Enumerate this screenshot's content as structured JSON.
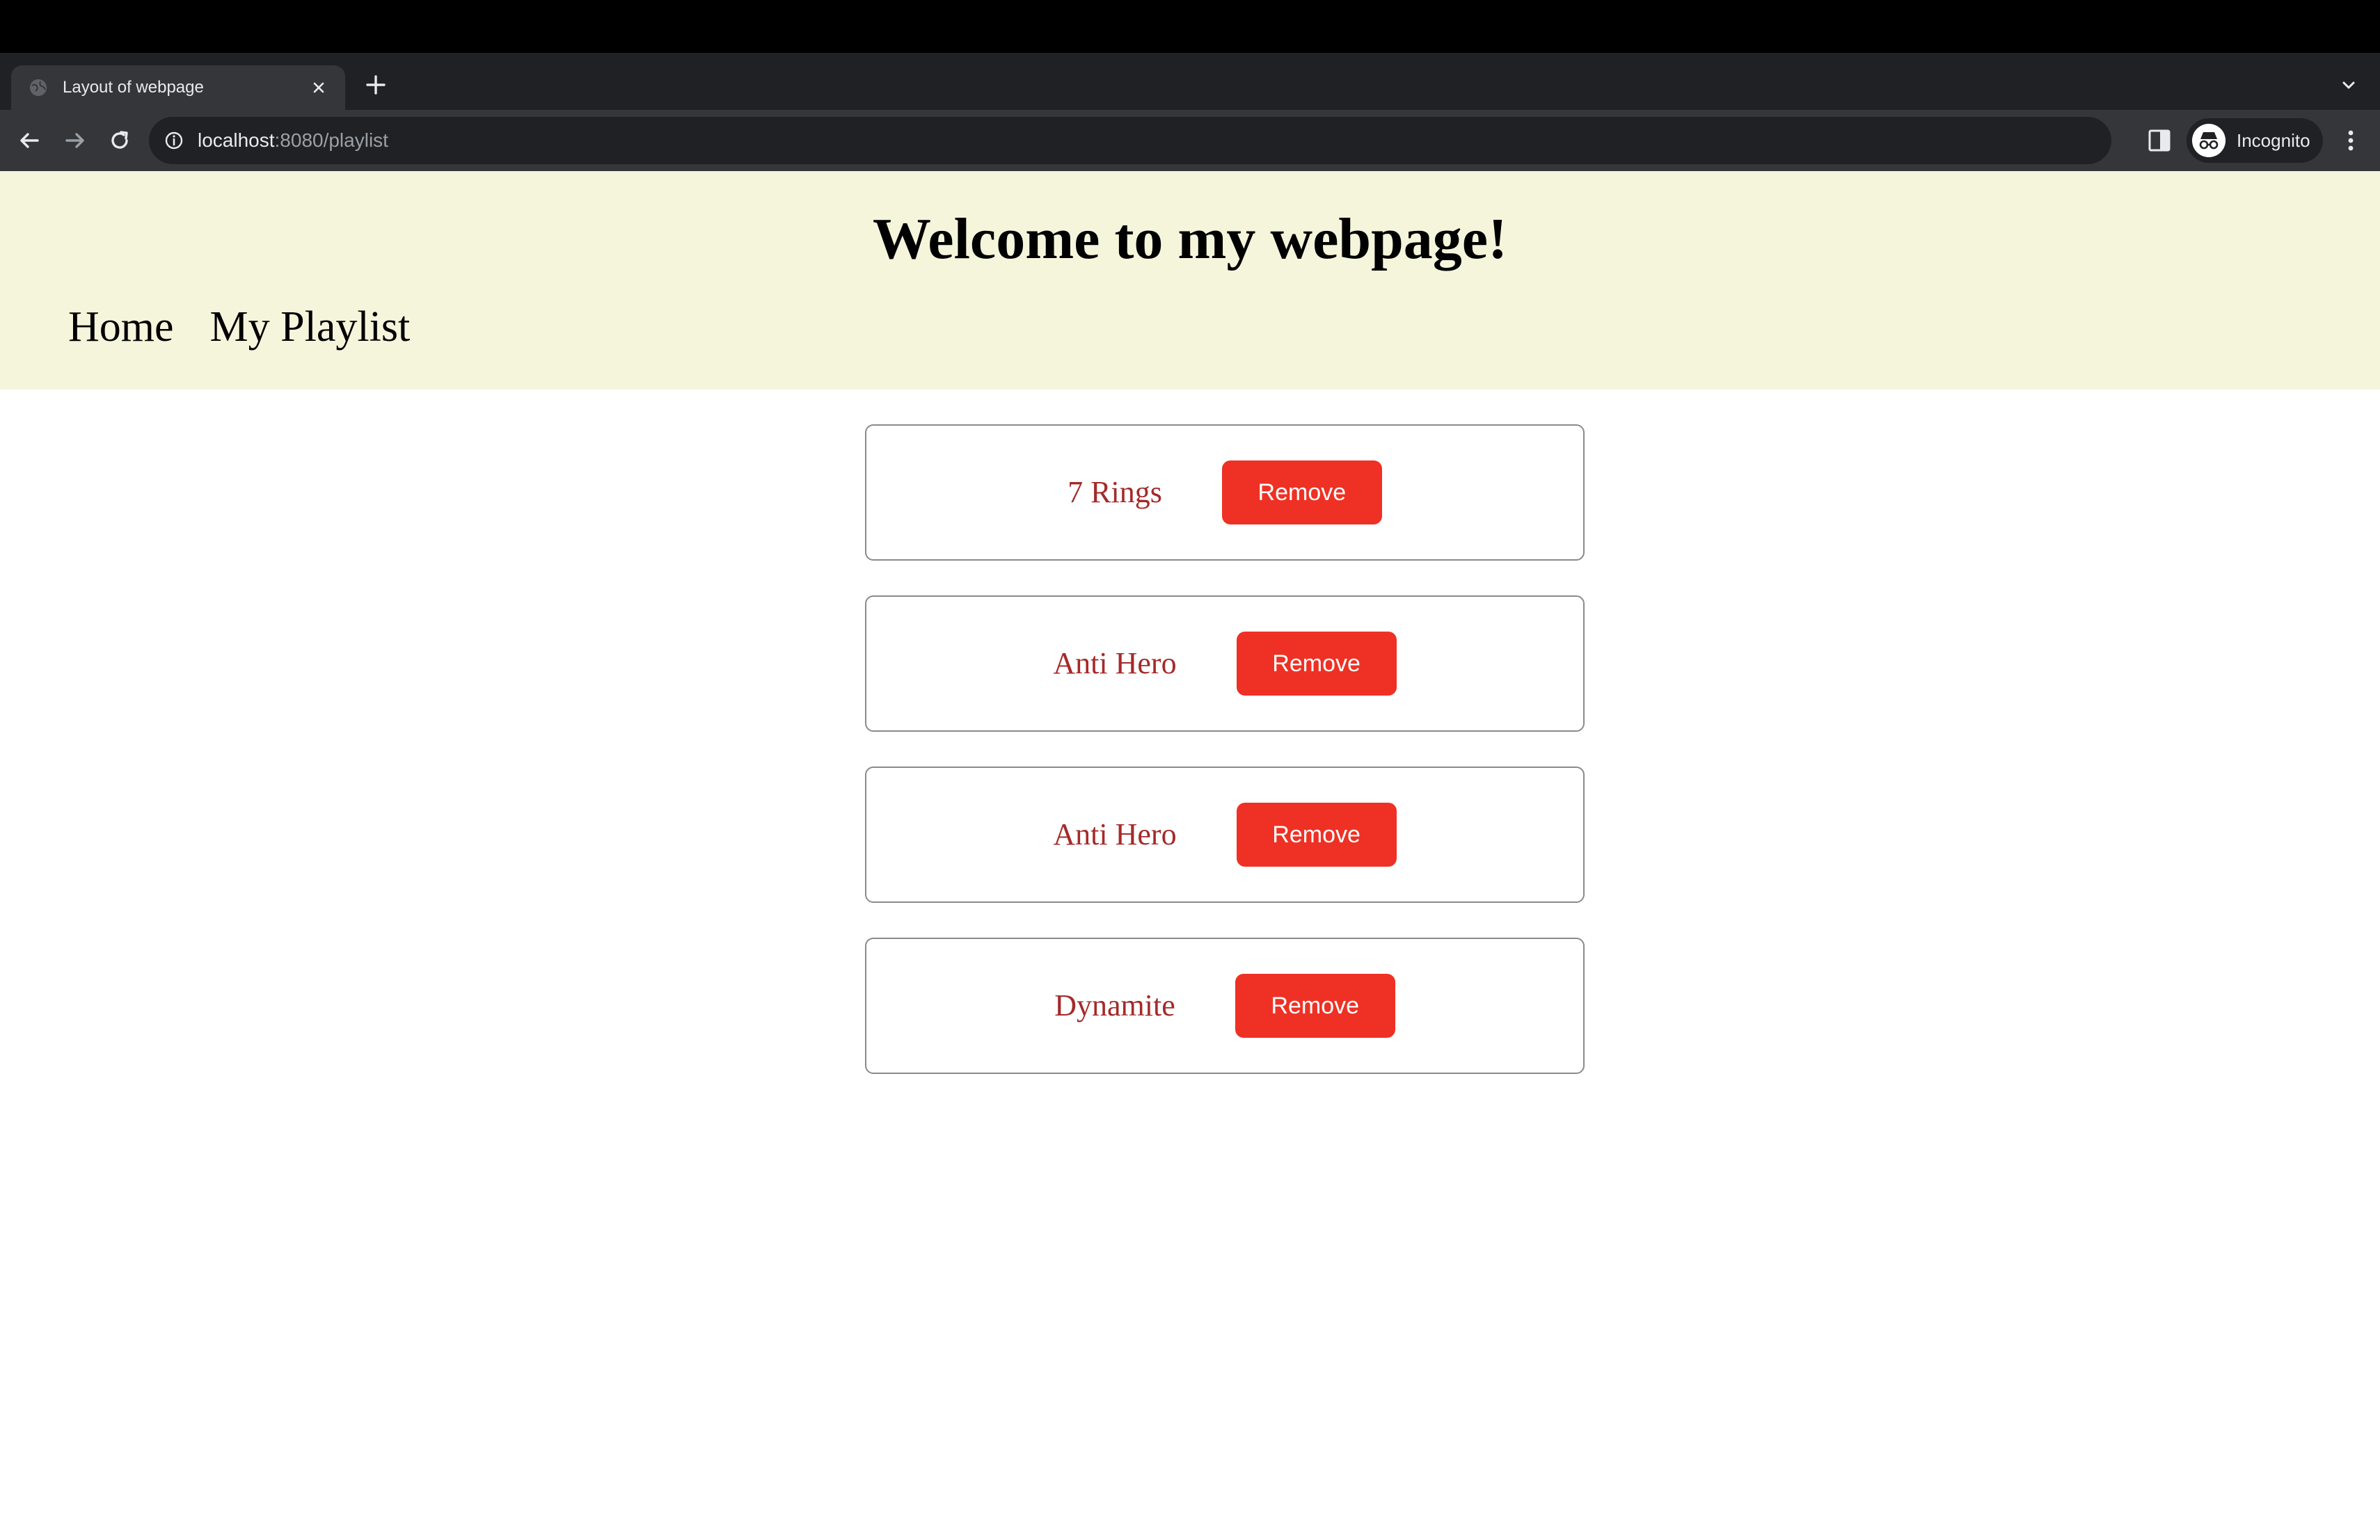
{
  "browser": {
    "tab_title": "Layout of webpage",
    "url_host": "localhost",
    "url_path": ":8080/playlist",
    "profile_label": "Incognito"
  },
  "page": {
    "heading": "Welcome to my webpage!",
    "nav": [
      {
        "label": "Home"
      },
      {
        "label": "My Playlist"
      }
    ],
    "songs": [
      {
        "title": "7 Rings",
        "button": "Remove"
      },
      {
        "title": "Anti Hero",
        "button": "Remove"
      },
      {
        "title": "Anti Hero",
        "button": "Remove"
      },
      {
        "title": "Dynamite",
        "button": "Remove"
      }
    ],
    "colors": {
      "header_bg": "#f5f5dc",
      "song_title": "#a52a2a",
      "remove_button": "#ee3124"
    }
  },
  "icons": [
    "globe-icon",
    "close-icon",
    "plus-icon",
    "chevron-down-icon",
    "back-arrow-icon",
    "forward-arrow-icon",
    "reload-icon",
    "info-icon",
    "zoom-icon",
    "star-icon",
    "side-panel-icon",
    "incognito-icon",
    "more-vert-icon"
  ]
}
